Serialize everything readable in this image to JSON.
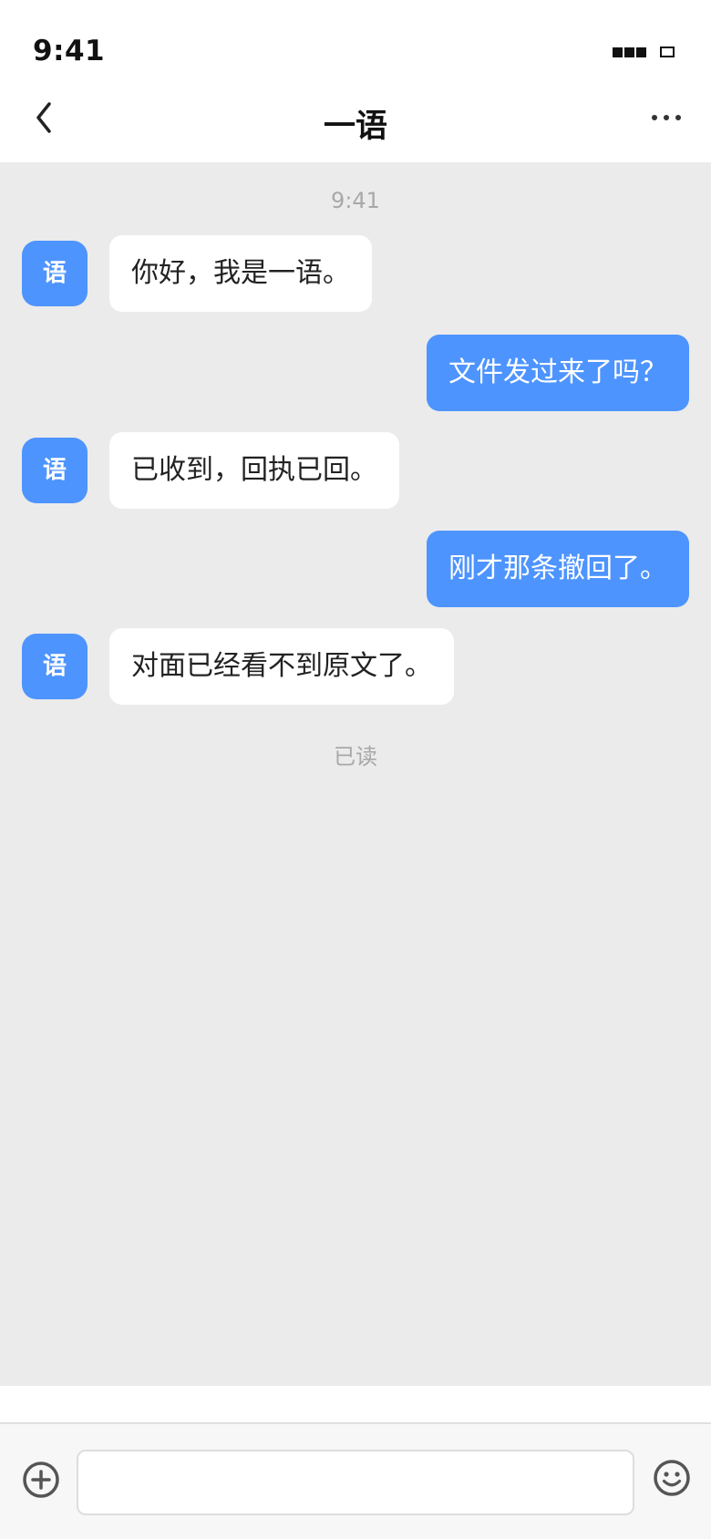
{
  "status_bar": {
    "time": "9:41",
    "signal_icon": "signal-icon",
    "battery_icon": "battery-icon"
  },
  "nav": {
    "title": "一语",
    "back_icon": "chevron-left-icon",
    "more_icon": "more-icon"
  },
  "chat": {
    "timestamp": "9:41",
    "messages": [
      {
        "sender": "other",
        "avatar_label": "语",
        "text": "你好，我是一语。"
      },
      {
        "sender": "me",
        "text": "文件发过来了吗？"
      },
      {
        "sender": "other",
        "avatar_label": "语",
        "text": "已收到，回执已回。"
      },
      {
        "sender": "me",
        "text": "刚才那条撤回了。"
      },
      {
        "sender": "other",
        "avatar_label": "语",
        "text": "对面已经看不到原文了。"
      }
    ],
    "read_status": "已读"
  },
  "input_bar": {
    "message_value": "",
    "plus_icon": "plus-circle-icon",
    "emoji_icon": "emoji-icon"
  },
  "colors": {
    "accent": "#4d94ff",
    "chat_background": "#ebebeb",
    "incoming_bubble": "#ffffff",
    "outgoing_bubble": "#4d94ff"
  }
}
